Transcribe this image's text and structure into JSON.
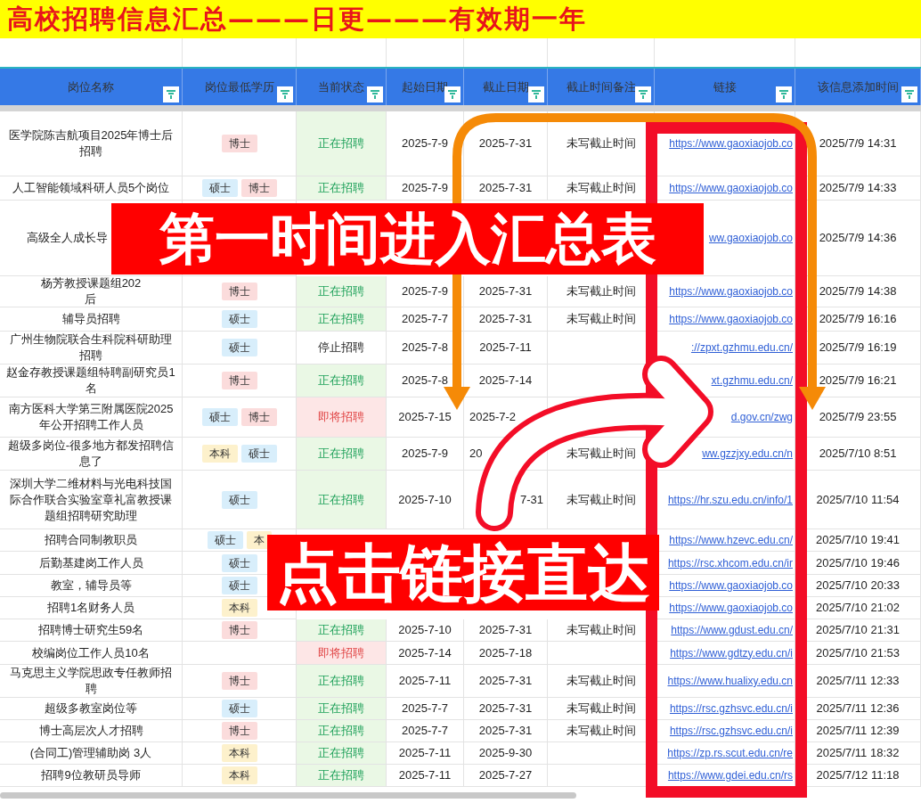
{
  "title": "高校招聘信息汇总———日更———有效期一年",
  "table": {
    "columns": [
      "岗位名称",
      "岗位最低学历",
      "当前状态",
      "起始日期",
      "截止日期",
      "截止时间备注",
      "链接",
      "该信息添加时间"
    ],
    "rows": [
      {
        "name": "医学院陈吉航项目2025年博士后招聘",
        "degrees": [
          {
            "text": "博士",
            "color": "#fbdcdc"
          }
        ],
        "status": {
          "text": "正在招聘",
          "kind": "open"
        },
        "start": "2025-7-9",
        "end": "2025-7-31",
        "note": "未写截止时间",
        "link": "https://www.gaoxiaojob.co",
        "added": "2025/7/9 14:31"
      },
      {
        "name": "人工智能领域科研人员5个岗位",
        "degrees": [
          {
            "text": "硕士",
            "color": "#d8eefb"
          },
          {
            "text": "博士",
            "color": "#fbdcdc"
          }
        ],
        "status": {
          "text": "正在招聘",
          "kind": "open"
        },
        "start": "2025-7-9",
        "end": "2025-7-31",
        "note": "未写截止时间",
        "link": "https://www.gaoxiaojob.co",
        "added": "2025/7/9 14:33"
      },
      {
        "name": "高级全人成长导",
        "link": "ww.gaoxiaojob.co",
        "added": "2025/7/9 14:36"
      },
      {
        "name": "杨芳教授课题组202\n后",
        "degrees": [
          {
            "text": "博士",
            "color": "#fbdcdc"
          }
        ],
        "status": {
          "text": "正在招聘",
          "kind": "open"
        },
        "start": "2025-7-9",
        "end": "2025-7-31",
        "note": "未写截止时间",
        "link": "https://www.gaoxiaojob.co",
        "added": "2025/7/9 14:38"
      },
      {
        "name": "辅导员招聘",
        "degrees": [
          {
            "text": "硕士",
            "color": "#d8eefb"
          }
        ],
        "status": {
          "text": "正在招聘",
          "kind": "open"
        },
        "start": "2025-7-7",
        "end": "2025-7-31",
        "note": "未写截止时间",
        "link": "https://www.gaoxiaojob.co",
        "added": "2025/7/9 16:16"
      },
      {
        "name": "广州生物院联合生科院科研助理招聘",
        "degrees": [
          {
            "text": "硕士",
            "color": "#d8eefb"
          }
        ],
        "status": {
          "text": "停止招聘",
          "kind": "stopped"
        },
        "start": "2025-7-8",
        "end": "2025-7-11",
        "link": "://zpxt.gzhmu.edu.cn/",
        "added": "2025/7/9 16:19"
      },
      {
        "name": "赵金存教授课题组特聘副研究员1名",
        "degrees": [
          {
            "text": "博士",
            "color": "#fbdcdc"
          }
        ],
        "status": {
          "text": "正在招聘",
          "kind": "open"
        },
        "start": "2025-7-8",
        "end": "2025-7-14",
        "link": "xt.gzhmu.edu.cn/",
        "added": "2025/7/9 16:21"
      },
      {
        "name": "南方医科大学第三附属医院2025年公开招聘工作人员",
        "degrees": [
          {
            "text": "硕士",
            "color": "#d8eefb"
          },
          {
            "text": "博士",
            "color": "#fbdcdc"
          }
        ],
        "status": {
          "text": "即将招聘",
          "kind": "upcoming"
        },
        "start": "2025-7-15",
        "end": "2025-7-2",
        "link": "d.gov.cn/zwg",
        "added": "2025/7/9 23:55"
      },
      {
        "name": "超级多岗位-很多地方都发招聘信息了",
        "degrees": [
          {
            "text": "本科",
            "color": "#fdf1cc"
          },
          {
            "text": "硕士",
            "color": "#d8eefb"
          }
        ],
        "status": {
          "text": "正在招聘",
          "kind": "open"
        },
        "start": "2025-7-9",
        "end": "20",
        "note": "未写截止时间",
        "link": "ww.gzzjxy.edu.cn/n",
        "added": "2025/7/10 8:51"
      },
      {
        "name": "深圳大学二维材料与光电科技国际合作联合实验室章礼富教授课题组招聘研究助理",
        "degrees": [
          {
            "text": "硕士",
            "color": "#d8eefb"
          }
        ],
        "status": {
          "text": "正在招聘",
          "kind": "open"
        },
        "start": "2025-7-10",
        "end": "7-31",
        "note": "未写截止时间",
        "link": "https://hr.szu.edu.cn/info/1",
        "added": "2025/7/10 11:54"
      },
      {
        "name": "招聘合同制教职员",
        "degrees": [
          {
            "text": "硕士",
            "color": "#d8eefb"
          },
          {
            "text": "本",
            "color": "#fdf1cc"
          }
        ],
        "link": "https://www.hzevc.edu.cn/",
        "added": "2025/7/10 19:41"
      },
      {
        "name": "后勤基建岗工作人员",
        "degrees": [
          {
            "text": "硕士",
            "color": "#d8eefb"
          }
        ],
        "link": "https://rsc.xhcom.edu.cn/ir",
        "added": "2025/7/10 19:46"
      },
      {
        "name": "教室，辅导员等",
        "degrees": [
          {
            "text": "硕士",
            "color": "#d8eefb"
          }
        ],
        "link": "https://www.gaoxiaojob.co",
        "added": "2025/7/10 20:33"
      },
      {
        "name": "招聘1名财务人员",
        "degrees": [
          {
            "text": "本科",
            "color": "#fdf1cc"
          }
        ],
        "link": "https://www.gaoxiaojob.co",
        "added": "2025/7/10 21:02"
      },
      {
        "name": "招聘博士研究生59名",
        "degrees": [
          {
            "text": "博士",
            "color": "#fbdcdc"
          }
        ],
        "status": {
          "text": "正在招聘",
          "kind": "open"
        },
        "start": "2025-7-10",
        "end": "2025-7-31",
        "note": "未写截止时间",
        "link": "https://www.gdust.edu.cn/",
        "added": "2025/7/10 21:31"
      },
      {
        "name": "校编岗位工作人员10名",
        "status": {
          "text": "即将招聘",
          "kind": "upcoming"
        },
        "start": "2025-7-14",
        "end": "2025-7-18",
        "link": "https://www.gdtzy.edu.cn/i",
        "added": "2025/7/10 21:53"
      },
      {
        "name": "马克思主义学院思政专任教师招聘",
        "degrees": [
          {
            "text": "博士",
            "color": "#fbdcdc"
          }
        ],
        "status": {
          "text": "正在招聘",
          "kind": "open"
        },
        "start": "2025-7-11",
        "end": "2025-7-31",
        "note": "未写截止时间",
        "link": "https://www.hualixy.edu.cn",
        "added": "2025/7/11 12:33"
      },
      {
        "name": "超级多教室岗位等",
        "degrees": [
          {
            "text": "硕士",
            "color": "#d8eefb"
          }
        ],
        "status": {
          "text": "正在招聘",
          "kind": "open"
        },
        "start": "2025-7-7",
        "end": "2025-7-31",
        "note": "未写截止时间",
        "link": "https://rsc.gzhsvc.edu.cn/i",
        "added": "2025/7/11 12:36"
      },
      {
        "name": "博士高层次人才招聘",
        "degrees": [
          {
            "text": "博士",
            "color": "#fbdcdc"
          }
        ],
        "status": {
          "text": "正在招聘",
          "kind": "open"
        },
        "start": "2025-7-7",
        "end": "2025-7-31",
        "note": "未写截止时间",
        "link": "https://rsc.gzhsvc.edu.cn/i",
        "added": "2025/7/11 12:39"
      },
      {
        "name": "(合同工)管理辅助岗 3人",
        "degrees": [
          {
            "text": "本科",
            "color": "#fdf1cc"
          }
        ],
        "status": {
          "text": "正在招聘",
          "kind": "open"
        },
        "start": "2025-7-11",
        "end": "2025-9-30",
        "link": "https://zp.rs.scut.edu.cn/re",
        "added": "2025/7/11 18:32"
      },
      {
        "name": "招聘9位教研员导师",
        "degrees": [
          {
            "text": "本科",
            "color": "#fdf1cc"
          }
        ],
        "status": {
          "text": "正在招聘",
          "kind": "open"
        },
        "start": "2025-7-11",
        "end": "2025-7-27",
        "link": "https://www.gdei.edu.cn/rs",
        "added": "2025/7/12 11:18"
      }
    ]
  },
  "banners": [
    "第一时间进入汇总表",
    "点击链接直达"
  ]
}
